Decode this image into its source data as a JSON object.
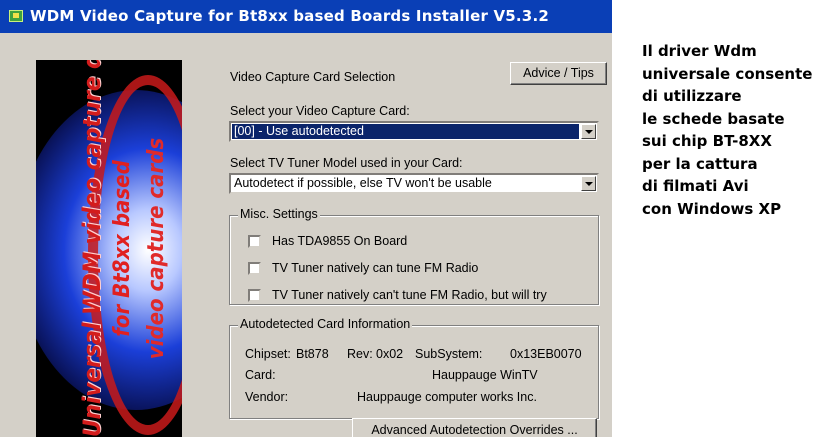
{
  "window": {
    "title": "WDM Video Capture for Bt8xx based Boards Installer V5.3.2"
  },
  "banner": {
    "line1": "Universal WDM video capture driver",
    "line2": "for Bt8xx based",
    "line3": "video capture cards"
  },
  "section_title": "Video Capture Card Selection",
  "advice_button": "Advice / Tips",
  "capture_card": {
    "label": "Select your Video Capture Card:",
    "value": "[00] - Use autodetected"
  },
  "tuner": {
    "label": "Select TV Tuner Model used in your Card:",
    "value": "Autodetect if possible, else TV won't be usable"
  },
  "misc": {
    "legend": "Misc. Settings",
    "options": [
      "Has TDA9855 On Board",
      "TV Tuner natively can tune FM Radio",
      "TV Tuner natively can't tune FM Radio, but will try"
    ]
  },
  "autodetect": {
    "legend": "Autodetected Card Information",
    "chipset_label": "Chipset:",
    "chipset_value": "Bt878",
    "rev_label": "Rev:",
    "rev_value": "0x02",
    "subsystem_label": "SubSystem:",
    "subsystem_value": "0x13EB0070",
    "card_label": "Card:",
    "card_value": "Hauppauge WinTV",
    "vendor_label": "Vendor:",
    "vendor_value": "Hauppauge computer works Inc."
  },
  "overrides_button": "Advanced Autodetection Overrides ...",
  "caption": {
    "lines": [
      "Il driver Wdm",
      "universale consente",
      "di utilizzare",
      "le schede basate",
      "sui chip BT-8XX",
      "per la cattura",
      "di filmati Avi",
      "con Windows XP"
    ]
  },
  "colors": {
    "titlebar": "#0a3fb6",
    "dialog_face": "#d4d0c8",
    "selection": "#0a246a",
    "banner_text": "#d31c1c"
  }
}
